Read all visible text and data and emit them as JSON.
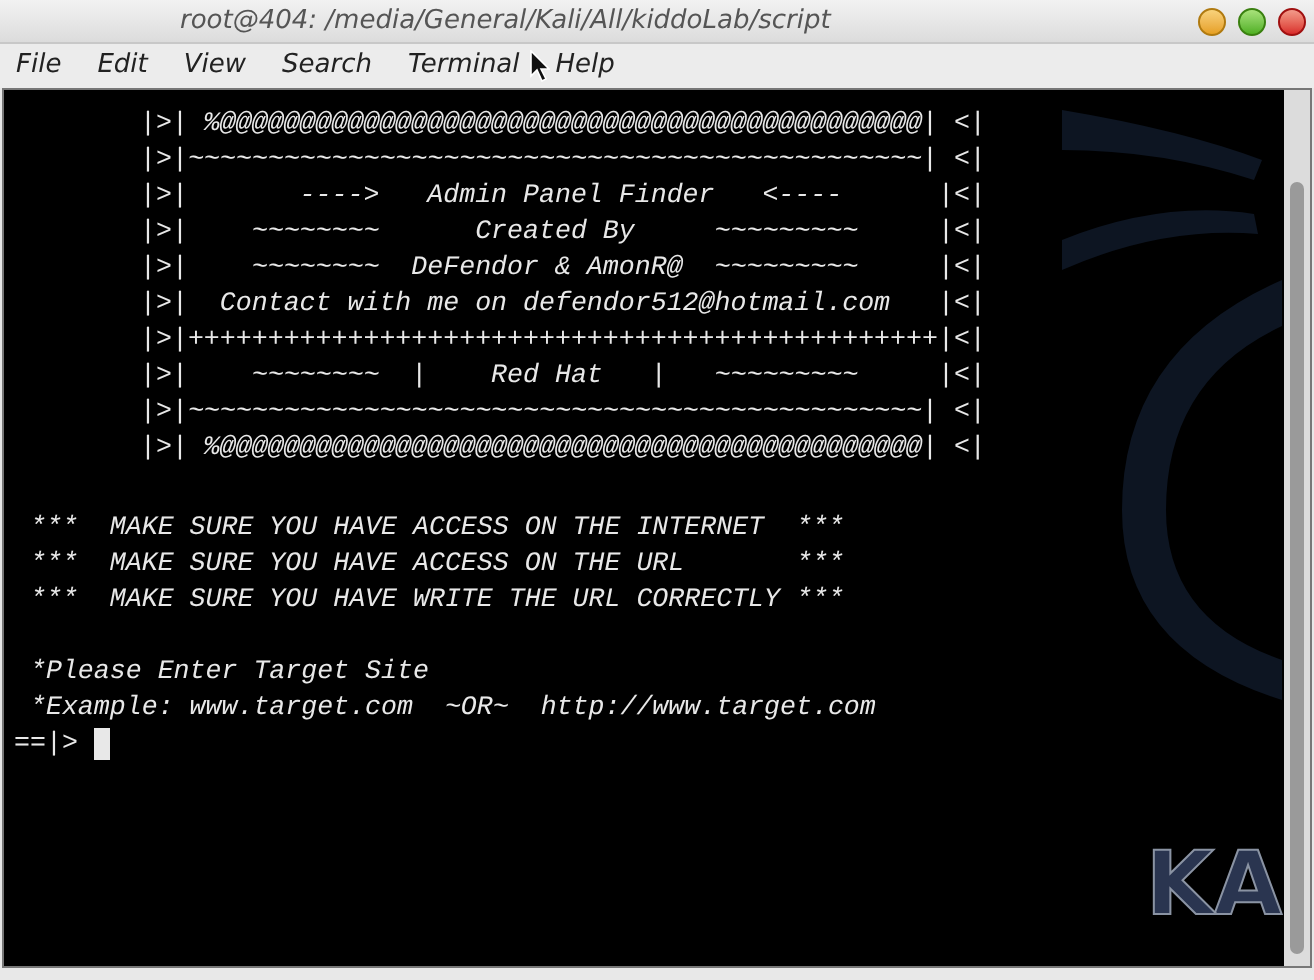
{
  "window": {
    "title": "root@404: /media/General/Kali/All/kiddoLab/script"
  },
  "menu": [
    {
      "label": "File"
    },
    {
      "label": "Edit"
    },
    {
      "label": "View"
    },
    {
      "label": "Search"
    },
    {
      "label": "Terminal"
    },
    {
      "label": "Help"
    }
  ],
  "terminal": {
    "background_logo_text": "KA",
    "banner": [
      "|>| %@@@@@@@@@@@@@@@@@@@@@@@@@@@@@@@@@@@@@@@@@@@@| <|",
      "|>|~~~~~~~~~~~~~~~~~~~~~~~~~~~~~~~~~~~~~~~~~~~~~~| <|",
      "|>|       ---->   Admin Panel Finder   <----      |<|",
      "|>|    ~~~~~~~~      Created By     ~~~~~~~~~     |<|",
      "|>|    ~~~~~~~~  DeFendor & AmonR@  ~~~~~~~~~     |<|",
      "|>|  Contact with me on defendor512@hotmail.com   |<|",
      "|>|+++++++++++++++++++++++++++++++++++++++++++++++|<|",
      "|>|    ~~~~~~~~  |    Red Hat   |   ~~~~~~~~~     |<|",
      "|>|~~~~~~~~~~~~~~~~~~~~~~~~~~~~~~~~~~~~~~~~~~~~~~| <|",
      "|>| %@@@@@@@@@@@@@@@@@@@@@@@@@@@@@@@@@@@@@@@@@@@@| <|"
    ],
    "warnings": [
      " ***  MAKE SURE YOU HAVE ACCESS ON THE INTERNET  ***",
      " ***  MAKE SURE YOU HAVE ACCESS ON THE URL       ***",
      " ***  MAKE SURE YOU HAVE WRITE THE URL CORRECTLY ***"
    ],
    "instructions": [
      " *Please Enter Target Site",
      " *Example: www.target.com  ~OR~  http://www.target.com"
    ],
    "prompt": "==|> "
  }
}
